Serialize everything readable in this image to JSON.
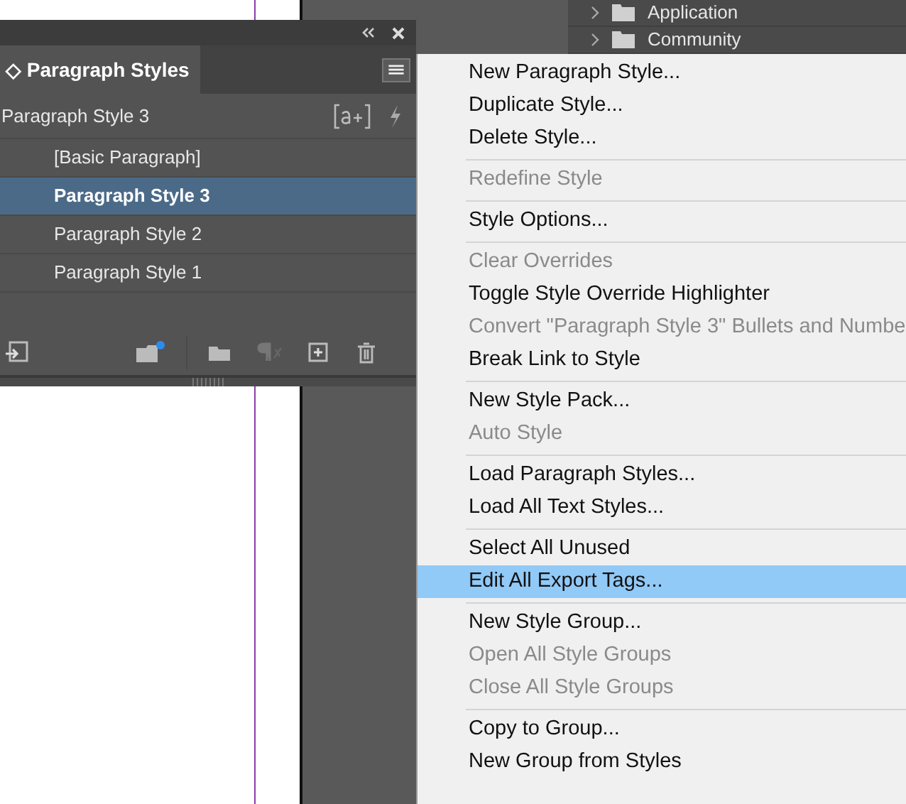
{
  "folders": [
    {
      "label": "Application"
    },
    {
      "label": "Community"
    }
  ],
  "panel": {
    "tab": "◇ Paragraph Styles",
    "current_style": "Paragraph Style 3",
    "styles": [
      {
        "label": "[Basic Paragraph]",
        "selected": false
      },
      {
        "label": "Paragraph Style 3",
        "selected": true
      },
      {
        "label": "Paragraph Style 2",
        "selected": false
      },
      {
        "label": "Paragraph Style 1",
        "selected": false
      }
    ]
  },
  "menu": {
    "items": [
      {
        "kind": "item",
        "label": "New Paragraph Style...",
        "disabled": false,
        "selected": false
      },
      {
        "kind": "item",
        "label": "Duplicate Style...",
        "disabled": false,
        "selected": false
      },
      {
        "kind": "item",
        "label": "Delete Style...",
        "disabled": false,
        "selected": false
      },
      {
        "kind": "separator"
      },
      {
        "kind": "item",
        "label": "Redefine Style",
        "disabled": true,
        "selected": false
      },
      {
        "kind": "separator"
      },
      {
        "kind": "item",
        "label": "Style Options...",
        "disabled": false,
        "selected": false
      },
      {
        "kind": "separator"
      },
      {
        "kind": "item",
        "label": "Clear Overrides",
        "disabled": true,
        "selected": false
      },
      {
        "kind": "item",
        "label": "Toggle Style Override Highlighter",
        "disabled": false,
        "selected": false
      },
      {
        "kind": "item",
        "label": "Convert \"Paragraph Style 3\" Bullets and Numbe",
        "disabled": true,
        "selected": false
      },
      {
        "kind": "item",
        "label": "Break Link to Style",
        "disabled": false,
        "selected": false
      },
      {
        "kind": "separator"
      },
      {
        "kind": "item",
        "label": "New Style Pack...",
        "disabled": false,
        "selected": false
      },
      {
        "kind": "item",
        "label": "Auto Style",
        "disabled": true,
        "selected": false
      },
      {
        "kind": "separator"
      },
      {
        "kind": "item",
        "label": "Load Paragraph Styles...",
        "disabled": false,
        "selected": false
      },
      {
        "kind": "item",
        "label": "Load All Text Styles...",
        "disabled": false,
        "selected": false
      },
      {
        "kind": "separator"
      },
      {
        "kind": "item",
        "label": "Select All Unused",
        "disabled": false,
        "selected": false
      },
      {
        "kind": "item",
        "label": "Edit All Export Tags...",
        "disabled": false,
        "selected": true
      },
      {
        "kind": "separator"
      },
      {
        "kind": "item",
        "label": "New Style Group...",
        "disabled": false,
        "selected": false
      },
      {
        "kind": "item",
        "label": "Open All Style Groups",
        "disabled": true,
        "selected": false
      },
      {
        "kind": "item",
        "label": "Close All Style Groups",
        "disabled": true,
        "selected": false
      },
      {
        "kind": "separator"
      },
      {
        "kind": "item",
        "label": "Copy to Group...",
        "disabled": false,
        "selected": false
      },
      {
        "kind": "item",
        "label": "New Group from Styles",
        "disabled": false,
        "selected": false
      }
    ]
  }
}
